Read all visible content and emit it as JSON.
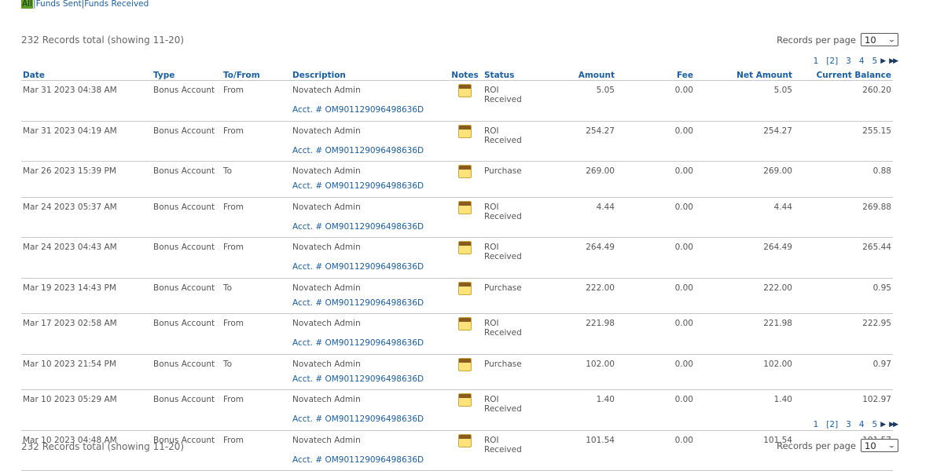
{
  "filters": {
    "all": "All",
    "sent": "Funds Sent",
    "received": "Funds Received"
  },
  "summary_text": "232 Records total (showing 11-20)",
  "records_per_page": {
    "label": "Records per page",
    "value": "10"
  },
  "pager": {
    "pages": [
      "1",
      "[2]",
      "3",
      "4",
      "5"
    ],
    "next_icon": "next-arrow-icon",
    "last_icon": "last-page-icon"
  },
  "columns": [
    "Date",
    "Type",
    "To/From",
    "Description",
    "Notes",
    "Status",
    "Amount",
    "Fee",
    "Net Amount",
    "Current Balance"
  ],
  "rows": [
    {
      "date": "Mar 31 2023 04:38 AM",
      "type": "Bonus Account",
      "tofrom": "From",
      "desc": "Novatech Admin",
      "acct": "Acct. # OM901129096498636D",
      "status": "ROI Received",
      "amount": "5.05",
      "fee": "0.00",
      "net": "5.05",
      "balance": "260.20"
    },
    {
      "date": "Mar 31 2023 04:19 AM",
      "type": "Bonus Account",
      "tofrom": "From",
      "desc": "Novatech Admin",
      "acct": "Acct. # OM901129096498636D",
      "status": "ROI Received",
      "amount": "254.27",
      "fee": "0.00",
      "net": "254.27",
      "balance": "255.15"
    },
    {
      "date": "Mar 26 2023 15:39 PM",
      "type": "Bonus Account",
      "tofrom": "To",
      "desc": "Novatech Admin",
      "acct": "Acct. # OM901129096498636D",
      "status": "Purchase",
      "amount": "269.00",
      "fee": "0.00",
      "net": "269.00",
      "balance": "0.88"
    },
    {
      "date": "Mar 24 2023 05:37 AM",
      "type": "Bonus Account",
      "tofrom": "From",
      "desc": "Novatech Admin",
      "acct": "Acct. # OM901129096498636D",
      "status": "ROI Received",
      "amount": "4.44",
      "fee": "0.00",
      "net": "4.44",
      "balance": "269.88"
    },
    {
      "date": "Mar 24 2023 04:43 AM",
      "type": "Bonus Account",
      "tofrom": "From",
      "desc": "Novatech Admin",
      "acct": "Acct. # OM901129096498636D",
      "status": "ROI Received",
      "amount": "264.49",
      "fee": "0.00",
      "net": "264.49",
      "balance": "265.44"
    },
    {
      "date": "Mar 19 2023 14:43 PM",
      "type": "Bonus Account",
      "tofrom": "To",
      "desc": "Novatech Admin",
      "acct": "Acct. # OM901129096498636D",
      "status": "Purchase",
      "amount": "222.00",
      "fee": "0.00",
      "net": "222.00",
      "balance": "0.95"
    },
    {
      "date": "Mar 17 2023 02:58 AM",
      "type": "Bonus Account",
      "tofrom": "From",
      "desc": "Novatech Admin",
      "acct": "Acct. # OM901129096498636D",
      "status": "ROI Received",
      "amount": "221.98",
      "fee": "0.00",
      "net": "221.98",
      "balance": "222.95"
    },
    {
      "date": "Mar 10 2023 21:54 PM",
      "type": "Bonus Account",
      "tofrom": "To",
      "desc": "Novatech Admin",
      "acct": "Acct. # OM901129096498636D",
      "status": "Purchase",
      "amount": "102.00",
      "fee": "0.00",
      "net": "102.00",
      "balance": "0.97"
    },
    {
      "date": "Mar 10 2023 05:29 AM",
      "type": "Bonus Account",
      "tofrom": "From",
      "desc": "Novatech Admin",
      "acct": "Acct. # OM901129096498636D",
      "status": "ROI Received",
      "amount": "1.40",
      "fee": "0.00",
      "net": "1.40",
      "balance": "102.97"
    },
    {
      "date": "Mar 10 2023 04:48 AM",
      "type": "Bonus Account",
      "tofrom": "From",
      "desc": "Novatech Admin",
      "acct": "Acct. # OM901129096498636D",
      "status": "ROI Received",
      "amount": "101.54",
      "fee": "0.00",
      "net": "101.54",
      "balance": "101.57"
    }
  ]
}
